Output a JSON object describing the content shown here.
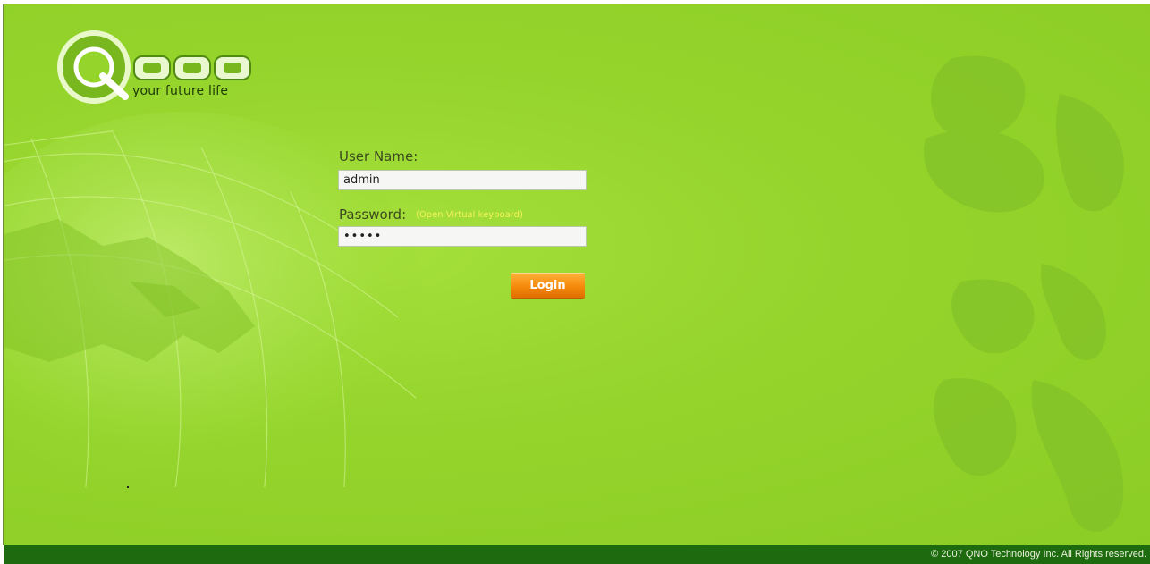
{
  "logo": {
    "tagline": "your future life",
    "brand": "QNO"
  },
  "login_form": {
    "username_label": "User Name:",
    "username_value": "admin",
    "password_label": "Password:",
    "virtual_keyboard_link": "(Open Virtual keyboard)",
    "password_value": "•••••",
    "login_button": "Login"
  },
  "footer": {
    "copyright": "© 2007 QNO Technology Inc. All Rights reserved."
  },
  "colors": {
    "background": "#94d42b",
    "footer": "#1e6b0f",
    "accent": "#f58a0c",
    "link": "#f4f25a"
  }
}
